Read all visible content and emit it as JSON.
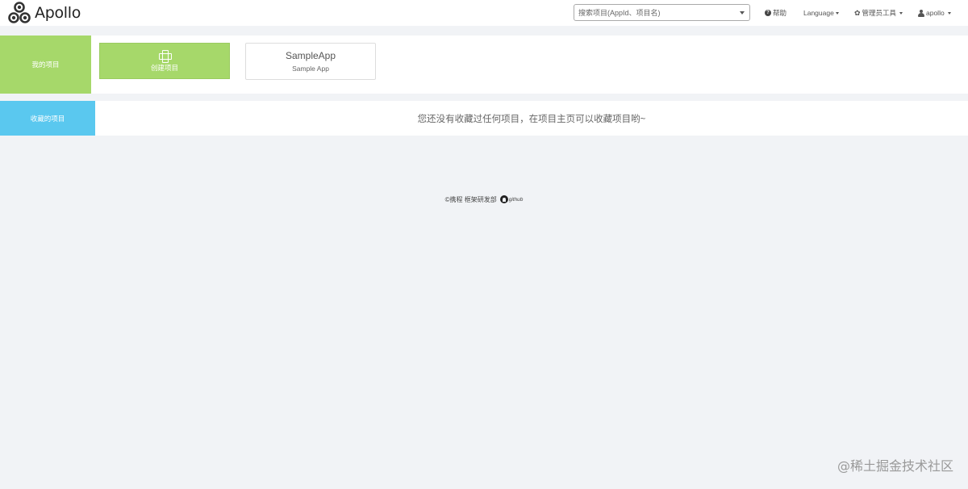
{
  "navbar": {
    "brand": "Apollo",
    "search_placeholder": "搜索项目(AppId、项目名)",
    "help_label": "帮助",
    "language_label": "Language",
    "admin_tools_label": "管理员工具",
    "user_label": "apollo"
  },
  "my_projects": {
    "label": "我的项目",
    "create_label": "创建项目",
    "apps": [
      {
        "app_id": "SampleApp",
        "name": "Sample App"
      }
    ]
  },
  "favorite_projects": {
    "label": "收藏的项目",
    "empty_message": "您还没有收藏过任何项目，在项目主页可以收藏项目哟~"
  },
  "footer": {
    "copyright": "©携程 框架研发部",
    "github": "github"
  },
  "watermark": "@稀土掘金技术社区",
  "colors": {
    "my_projects_accent": "#a6d86a",
    "favorites_accent": "#5ac8ef",
    "page_background": "#f1f3f6"
  }
}
